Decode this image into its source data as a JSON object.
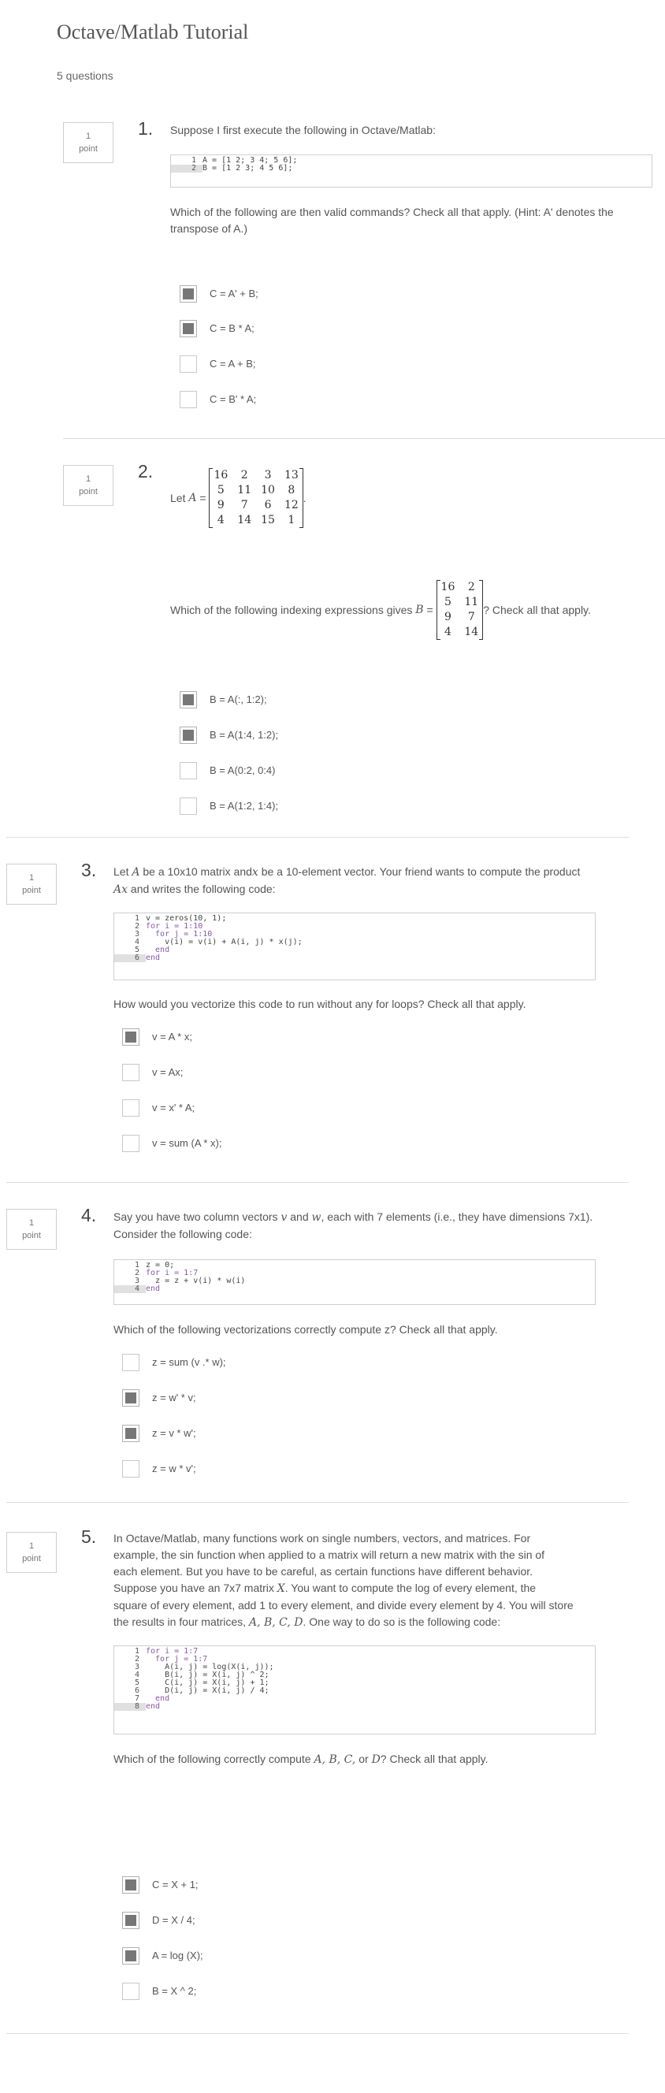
{
  "page": {
    "title": "Octave/Matlab Tutorial",
    "question_count": "5 questions"
  },
  "questions": [
    {
      "points": "1",
      "points_unit": "point",
      "number": "1.",
      "text": "Suppose I first execute the following in Octave/Matlab:",
      "code": [
        {
          "n": "1",
          "t": "A = [1 2; 3 4; 5 6];"
        },
        {
          "n": "2",
          "t": "B = [1 2 3; 4 5 6];"
        }
      ],
      "question2": "Which of the following are then valid commands? Check all that apply. (Hint: A' denotes the transpose of A.)",
      "options": [
        {
          "label": "C = A' + B;",
          "checked": true
        },
        {
          "label": "C = B * A;",
          "checked": true
        },
        {
          "label": "C = A + B;",
          "checked": false
        },
        {
          "label": "C = B' * A;",
          "checked": false
        }
      ]
    },
    {
      "points": "1",
      "points_unit": "point",
      "number": "2.",
      "let_text": "Let",
      "matrix_A": [
        [
          "16",
          "2",
          "3",
          "13"
        ],
        [
          "5",
          "11",
          "10",
          "8"
        ],
        [
          "9",
          "7",
          "6",
          "12"
        ],
        [
          "4",
          "14",
          "15",
          "1"
        ]
      ],
      "text_before": "Which of the following indexing expressions gives",
      "text_after": "? Check all that apply.",
      "matrix_B": [
        [
          "16",
          "2"
        ],
        [
          "5",
          "11"
        ],
        [
          "9",
          "7"
        ],
        [
          "4",
          "14"
        ]
      ],
      "options": [
        {
          "label": "B = A(:, 1:2);",
          "checked": true
        },
        {
          "label": "B = A(1:4, 1:2);",
          "checked": true
        },
        {
          "label": "B = A(0:2, 0:4)",
          "checked": false
        },
        {
          "label": "B = A(1:2, 1:4);",
          "checked": false
        }
      ]
    },
    {
      "points": "1",
      "points_unit": "point",
      "number": "3.",
      "text_parts": [
        "Let ",
        " be a 10x10 matrix and",
        " be a 10-element vector. Your friend wants to compute the product ",
        " and writes the following code:"
      ],
      "code": [
        {
          "n": "1",
          "t": "v = zeros(10, 1);"
        },
        {
          "n": "2",
          "t": "for i = 1:10"
        },
        {
          "n": "3",
          "t": "  for j = 1:10"
        },
        {
          "n": "4",
          "t": "    v(i) = v(i) + A(i, j) * x(j);"
        },
        {
          "n": "5",
          "t": "  end"
        },
        {
          "n": "6",
          "t": "end"
        }
      ],
      "question2": "How would you vectorize this code to run without any for loops? Check all that apply.",
      "options": [
        {
          "label": "v = A * x;",
          "checked": true
        },
        {
          "label": "v = Ax;",
          "checked": false
        },
        {
          "label": "v = x' * A;",
          "checked": false
        },
        {
          "label": "v = sum (A * x);",
          "checked": false
        }
      ]
    },
    {
      "points": "1",
      "points_unit": "point",
      "number": "4.",
      "text_parts": [
        "Say you have two column vectors ",
        " and ",
        ", each with 7 elements (i.e., they have dimensions 7x1). Consider the following code:"
      ],
      "code": [
        {
          "n": "1",
          "t": "z = 0;"
        },
        {
          "n": "2",
          "t": "for i = 1:7"
        },
        {
          "n": "3",
          "t": "  z = z + v(i) * w(i)"
        },
        {
          "n": "4",
          "t": "end"
        }
      ],
      "question2": "Which of the following vectorizations correctly compute z? Check all that apply.",
      "options": [
        {
          "label": "z = sum (v .* w);",
          "checked": false
        },
        {
          "label": "z = w' * v;",
          "checked": true
        },
        {
          "label": "z = v * w';",
          "checked": true
        },
        {
          "label": "z = w * v';",
          "checked": false
        }
      ]
    },
    {
      "points": "1",
      "points_unit": "point",
      "number": "5.",
      "text_lines": [
        "In Octave/Matlab, many functions work on single numbers, vectors, and matrices. For",
        "example, the sin function when applied to a matrix will return a new matrix with the sin of",
        "each element. But you have to be careful, as certain functions have different behavior.",
        "Suppose you have an 7x7 matrix",
        "square of every element, add 1 to every element, and divide every element by 4. You will store",
        "the results in four matrices,"
      ],
      "text_line4_tail": ". You want to compute the log of every element, the",
      "text_line6_tail": ". One way to do so is the following code:",
      "code": [
        {
          "n": "1",
          "t": "for i = 1:7"
        },
        {
          "n": "2",
          "t": "  for j = 1:7"
        },
        {
          "n": "3",
          "t": "    A(i, j) = log(X(i, j));"
        },
        {
          "n": "4",
          "t": "    B(i, j) = X(i, j) ^ 2;"
        },
        {
          "n": "5",
          "t": "    C(i, j) = X(i, j) + 1;"
        },
        {
          "n": "6",
          "t": "    D(i, j) = X(i, j) / 4;"
        },
        {
          "n": "7",
          "t": "  end"
        },
        {
          "n": "8",
          "t": "end"
        }
      ],
      "question2_before": "Which of the following correctly compute",
      "question2_after": "? Check all that apply.",
      "options": [
        {
          "label": "C = X + 1;",
          "checked": true
        },
        {
          "label": "D = X / 4;",
          "checked": true
        },
        {
          "label": "A = log (X);",
          "checked": true
        },
        {
          "label": "B = X ^ 2;",
          "checked": false
        }
      ]
    }
  ]
}
